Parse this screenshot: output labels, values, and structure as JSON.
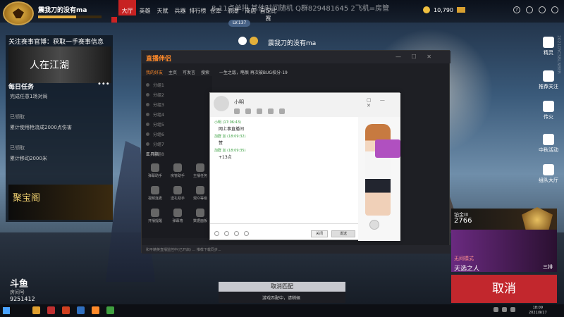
{
  "topbar": {
    "username": "震我刀的没有ma",
    "nav": [
      "大厅",
      "英雄",
      "天赋",
      "兵器",
      "排行榜",
      "仓库",
      "浪潮",
      "商店",
      "自定比赛"
    ],
    "active_tab": "大厅",
    "overlay": "8-11点单排 其他时间随机 Q群829481645   2飞机=房管",
    "coins": "10,790",
    "level_pill": "LV.137"
  },
  "center": {
    "player_name": "震我刀的没有ma"
  },
  "left_panel": {
    "title": "关注赛事官博：获取一手赛事信息",
    "banner_text": "人在江湖",
    "task_header": "每日任务",
    "tasks": [
      {
        "text": "完成任意1场对局",
        "status": "已领取"
      },
      {
        "text": "累计使用枪流成2000点伤害",
        "status": "已领取"
      },
      {
        "text": "累计移动2000米",
        "status": "已领取"
      }
    ],
    "treasure": "聚宝阁"
  },
  "douyu": {
    "logo": "斗鱼",
    "sub": "房间号",
    "room": "9251412"
  },
  "right_menu": [
    "精灵",
    "推荐关注",
    "传火",
    "中秋活动",
    "组队大厅"
  ],
  "client": {
    "logo": "直播伴侣",
    "tabs": [
      "我的好友",
      "主页",
      "可发言",
      "搜索"
    ],
    "contacts": [
      "分组1",
      "分组2",
      "分组3",
      "分组4",
      "分组5",
      "分组6",
      "分组7",
      "分组8"
    ],
    "tools_title": "工具箱",
    "tools": [
      "弹幕助手",
      "房管助手",
      "主播任务",
      "视频连麦",
      "送礼助手",
      "观众等级",
      "开播提醒",
      "弹幕墙",
      "数据面板"
    ],
    "room_text": "一生之敌，略恨 再次被BUG校分-19",
    "status": "和平精英直播监控中(已开启) ... 推荐下载同步..."
  },
  "dialog": {
    "name": "小明",
    "messages": [
      {
        "meta": "小明 (17:06:43)",
        "body": "网上事直播间"
      },
      {
        "meta": "加群 加 (18:09:32)",
        "body": "赞"
      },
      {
        "meta": "加群 加 (18:09:35)",
        "body": "+13点"
      }
    ],
    "close_btn": "关闭",
    "send_btn": "发送"
  },
  "game_right": {
    "list_cancel": "取消",
    "rank_name": "铂金III",
    "rank_num": "2766",
    "mode_title": "无间模式",
    "mode_name": "天选之人",
    "mode_right": "三排",
    "big_cancel": "取消"
  },
  "match": {
    "bar": "取消匹配",
    "sub": "游戏匹配中，请稍候"
  },
  "taskbar": {
    "time": "18:09",
    "date": "2021/9/17"
  },
  "side_text": "2021DYCSBLNBER"
}
